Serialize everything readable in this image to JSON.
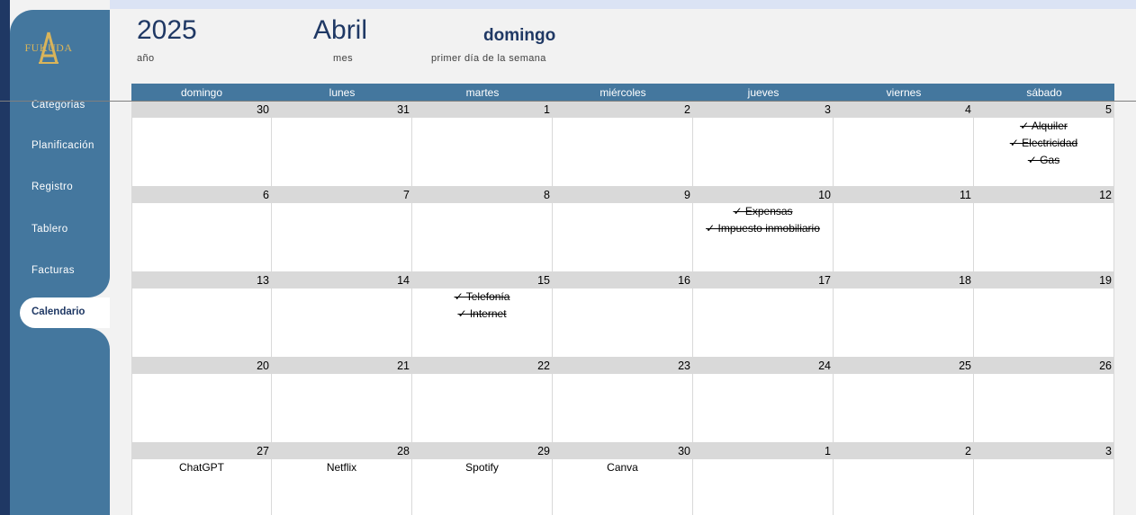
{
  "brand": {
    "name": "FUKUDA",
    "logo_color": "#d9b45a"
  },
  "colors": {
    "sidebar": "#44779e",
    "navy": "#1f3864",
    "cell_header": "#d9d9d9"
  },
  "sidebar": {
    "items": [
      {
        "label": "Categorias",
        "active": false
      },
      {
        "label": "Planificación",
        "active": false
      },
      {
        "label": "Registro",
        "active": false
      },
      {
        "label": "Tablero",
        "active": false
      },
      {
        "label": "Facturas",
        "active": false
      },
      {
        "label": "Calendario",
        "active": true
      }
    ]
  },
  "selectors": {
    "year": {
      "value": "2025",
      "label": "año"
    },
    "month": {
      "value": "Abril",
      "label": "mes"
    },
    "first_day": {
      "value": "domingo",
      "label": "primer día de la semana"
    }
  },
  "calendar": {
    "day_headers": [
      "domingo",
      "lunes",
      "martes",
      "miércoles",
      "jueves",
      "viernes",
      "sábado"
    ],
    "weeks": [
      [
        {
          "day": "30",
          "events": []
        },
        {
          "day": "31",
          "events": []
        },
        {
          "day": "1",
          "events": []
        },
        {
          "day": "2",
          "events": []
        },
        {
          "day": "3",
          "events": []
        },
        {
          "day": "4",
          "events": []
        },
        {
          "day": "5",
          "events": [
            {
              "text": "✓ Alquiler",
              "done": true
            },
            {
              "text": "✓ Electricidad",
              "done": true
            },
            {
              "text": "✓ Gas",
              "done": true
            }
          ]
        }
      ],
      [
        {
          "day": "6",
          "events": []
        },
        {
          "day": "7",
          "events": []
        },
        {
          "day": "8",
          "events": []
        },
        {
          "day": "9",
          "events": []
        },
        {
          "day": "10",
          "events": [
            {
              "text": "✓ Expensas",
              "done": true
            },
            {
              "text": "✓ Impuesto inmobiliario",
              "done": true
            }
          ]
        },
        {
          "day": "11",
          "events": []
        },
        {
          "day": "12",
          "events": []
        }
      ],
      [
        {
          "day": "13",
          "events": []
        },
        {
          "day": "14",
          "events": []
        },
        {
          "day": "15",
          "events": [
            {
              "text": "✓ Telefonía",
              "done": true
            },
            {
              "text": "✓ Internet",
              "done": true
            }
          ]
        },
        {
          "day": "16",
          "events": []
        },
        {
          "day": "17",
          "events": []
        },
        {
          "day": "18",
          "events": []
        },
        {
          "day": "19",
          "events": []
        }
      ],
      [
        {
          "day": "20",
          "events": []
        },
        {
          "day": "21",
          "events": []
        },
        {
          "day": "22",
          "events": []
        },
        {
          "day": "23",
          "events": []
        },
        {
          "day": "24",
          "events": []
        },
        {
          "day": "25",
          "events": []
        },
        {
          "day": "26",
          "events": []
        }
      ],
      [
        {
          "day": "27",
          "events": [
            {
              "text": "ChatGPT",
              "done": false
            }
          ]
        },
        {
          "day": "28",
          "events": [
            {
              "text": "Netflix",
              "done": false
            }
          ]
        },
        {
          "day": "29",
          "events": [
            {
              "text": "Spotify",
              "done": false
            }
          ]
        },
        {
          "day": "30",
          "events": [
            {
              "text": "Canva",
              "done": false
            }
          ]
        },
        {
          "day": "1",
          "events": []
        },
        {
          "day": "2",
          "events": []
        },
        {
          "day": "3",
          "events": []
        }
      ]
    ]
  }
}
